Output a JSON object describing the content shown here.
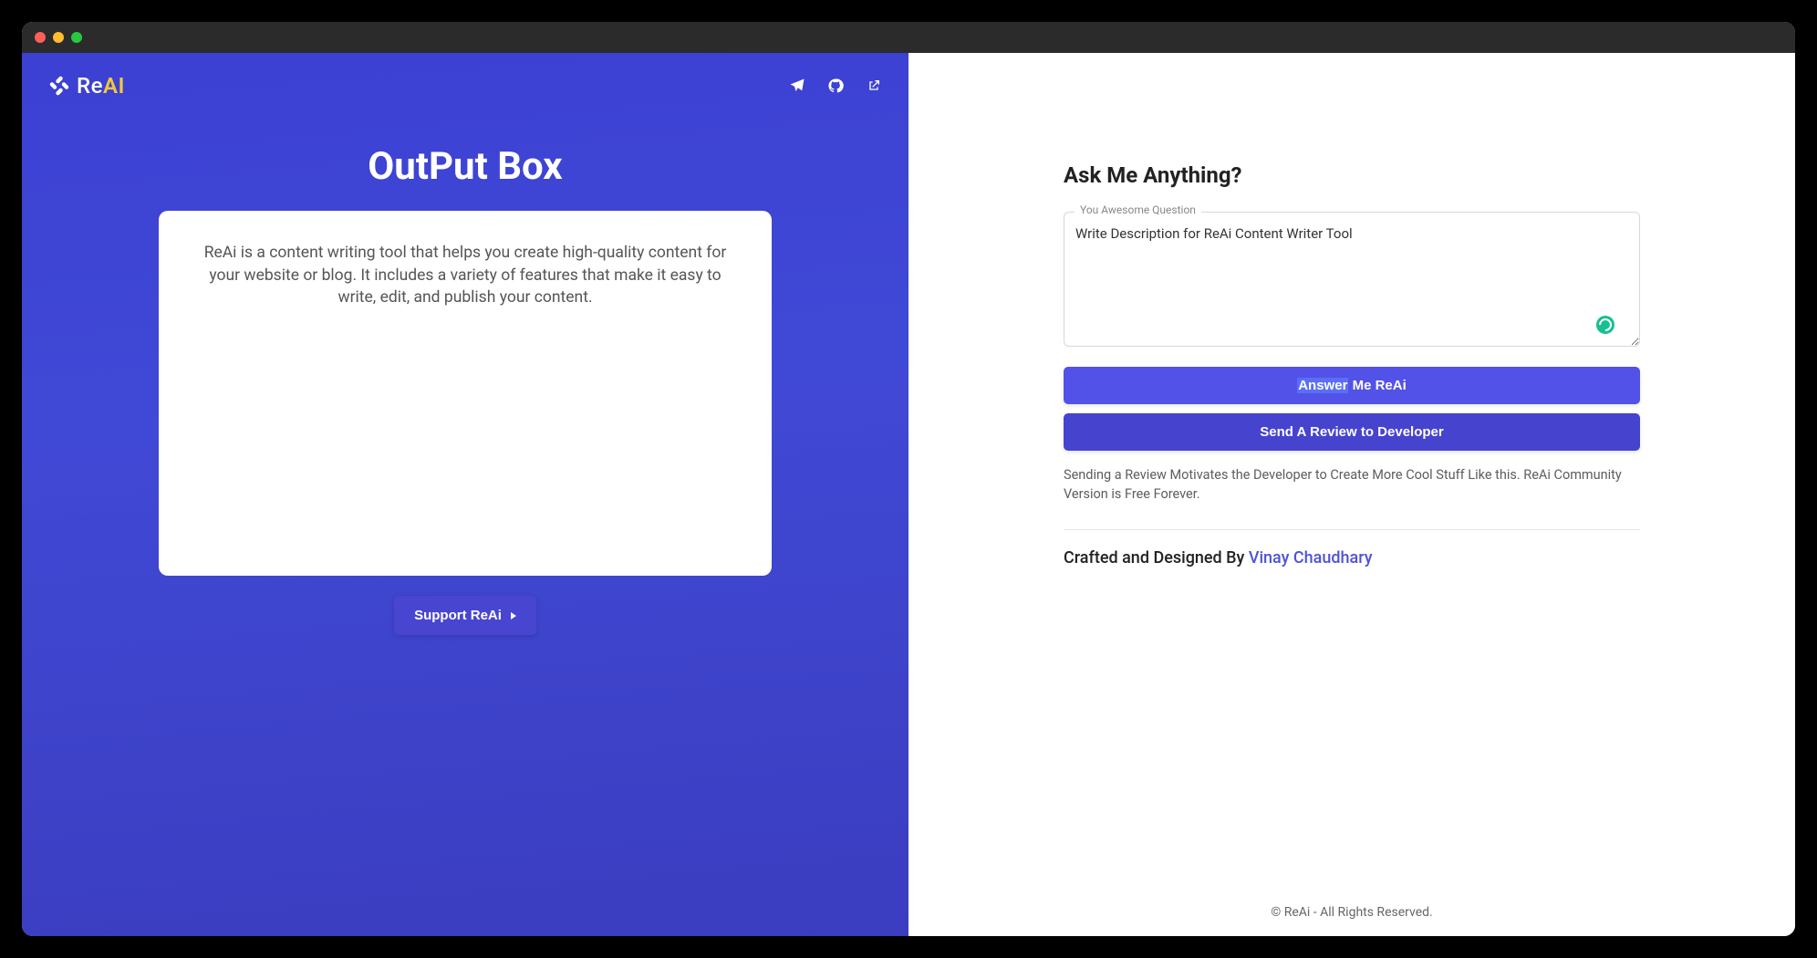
{
  "brand": {
    "re": "Re",
    "al": "AI"
  },
  "left": {
    "title": "OutPut Box",
    "output_text": "ReAi is a content writing tool that helps you create high-quality content for your website or blog. It includes a variety of features that make it easy to write, edit, and publish your content.",
    "support_label": "Support ReAi"
  },
  "right": {
    "heading": "Ask Me Anything?",
    "legend": "You Awesome Question",
    "question_value": "Write Description for ReAi Content Writer Tool",
    "answer_hl": "Answer",
    "answer_rest": " Me ReAi",
    "review_btn": "Send A Review to Developer",
    "review_note": "Sending a Review Motivates the Developer to Create More Cool Stuff Like this. ReAi Community Version is Free Forever.",
    "crafted_prefix": "Crafted and Designed By ",
    "crafted_name": "Vinay Chaudhary",
    "footer": "© ReAi - All Rights Reserved."
  }
}
